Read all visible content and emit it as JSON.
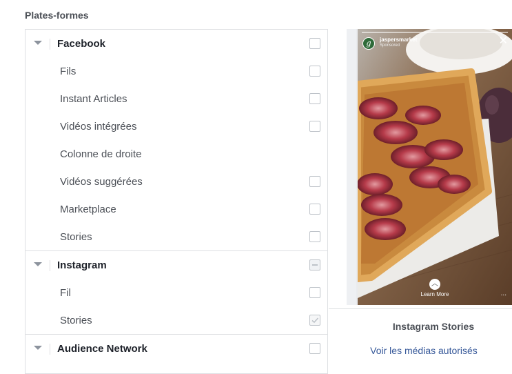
{
  "section": {
    "title": "Plates-formes"
  },
  "platforms": [
    {
      "label": "Facebook",
      "state": "unchecked",
      "items": [
        {
          "label": "Fils",
          "checkbox": true,
          "state": "unchecked"
        },
        {
          "label": "Instant Articles",
          "checkbox": true,
          "state": "unchecked"
        },
        {
          "label": "Vidéos intégrées",
          "checkbox": true,
          "state": "unchecked"
        },
        {
          "label": "Colonne de droite",
          "checkbox": false,
          "state": "none"
        },
        {
          "label": "Vidéos suggérées",
          "checkbox": true,
          "state": "unchecked"
        },
        {
          "label": "Marketplace",
          "checkbox": true,
          "state": "unchecked"
        },
        {
          "label": "Stories",
          "checkbox": true,
          "state": "unchecked"
        }
      ]
    },
    {
      "label": "Instagram",
      "state": "mixed",
      "items": [
        {
          "label": "Fil",
          "checkbox": true,
          "state": "unchecked"
        },
        {
          "label": "Stories",
          "checkbox": true,
          "state": "checked"
        }
      ]
    },
    {
      "label": "Audience Network",
      "state": "unchecked",
      "items": []
    }
  ],
  "preview": {
    "account": "jaspersmarket",
    "sponsored": "Sponsored",
    "avatar_letter": "g",
    "close_icon": "close-icon",
    "cta": "Learn More",
    "more": "...",
    "placement_name": "Instagram Stories",
    "media_link": "Voir les médias autorisés"
  },
  "colors": {
    "border": "#dddfe2",
    "link": "#365899",
    "heading": "#4b4f56"
  }
}
